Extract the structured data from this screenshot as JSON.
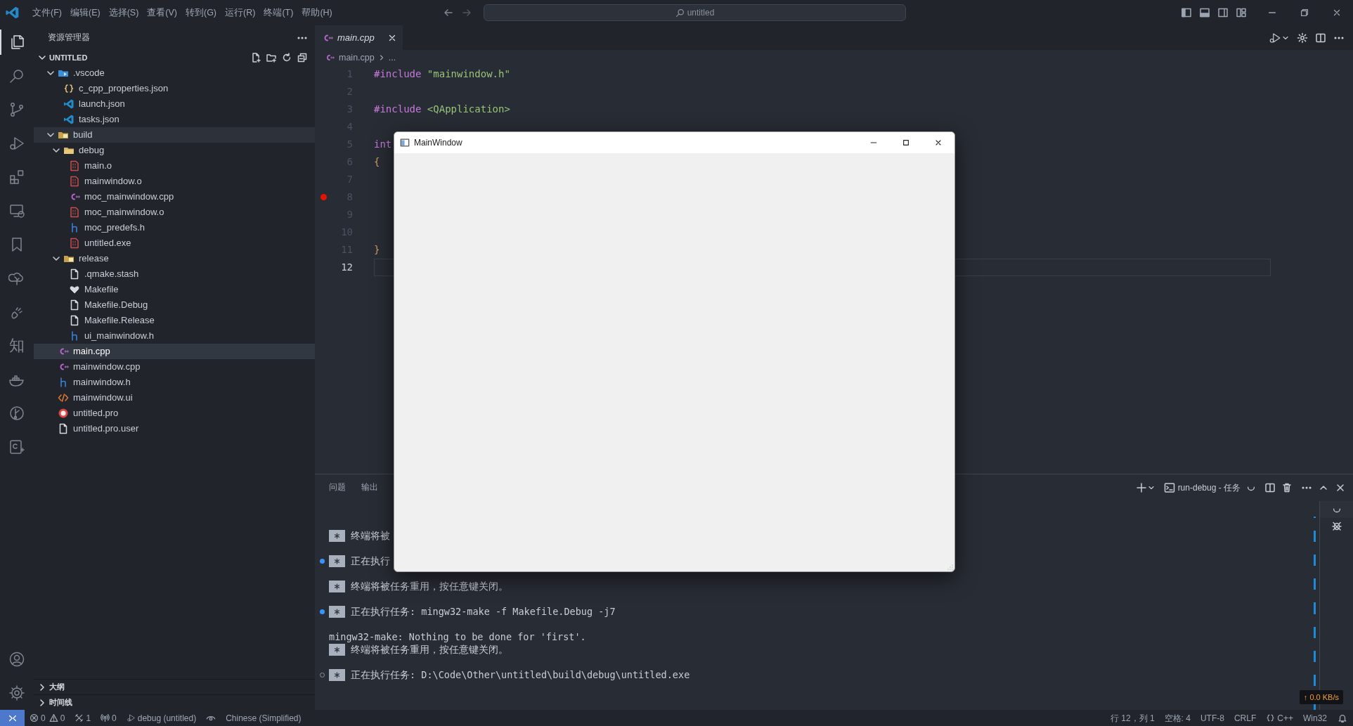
{
  "title_bar": {
    "menus": [
      "文件(F)",
      "编辑(E)",
      "选择(S)",
      "查看(V)",
      "转到(G)",
      "运行(R)",
      "终端(T)",
      "帮助(H)"
    ],
    "search": {
      "text": "untitled"
    }
  },
  "activity_bar": {
    "items": [
      {
        "kind": "explorer",
        "selected": true
      },
      {
        "kind": "search",
        "selected": false
      },
      {
        "kind": "git",
        "selected": false
      },
      {
        "kind": "debug",
        "selected": false
      },
      {
        "kind": "extensions",
        "selected": false
      },
      {
        "kind": "remote",
        "selected": false
      },
      {
        "kind": "bookmark",
        "selected": false
      },
      {
        "kind": "tree",
        "selected": false
      },
      {
        "kind": "hand",
        "selected": false
      },
      {
        "kind": "glyph",
        "text": "知",
        "selected": false
      },
      {
        "kind": "docker",
        "selected": false
      },
      {
        "kind": "graph",
        "selected": false
      },
      {
        "kind": "cmake",
        "selected": false
      }
    ],
    "bottom": [
      {
        "kind": "account"
      },
      {
        "kind": "settings"
      }
    ]
  },
  "sidebar": {
    "title": "资源管理器",
    "workspace": {
      "label": "UNTITLED",
      "expanded": true
    },
    "tree": [
      {
        "label": ".vscode",
        "kind": "vscodefolder",
        "expanded": true,
        "selected": false,
        "hovered": false,
        "children": [
          {
            "label": "c_cpp_properties.json",
            "kind": "braces",
            "selected": false,
            "hovered": false
          },
          {
            "label": "launch.json",
            "kind": "vscode",
            "selected": false,
            "hovered": false
          },
          {
            "label": "tasks.json",
            "kind": "vscode",
            "selected": false,
            "hovered": false
          }
        ]
      },
      {
        "label": "build",
        "kind": "buildfolder",
        "expanded": true,
        "selected": false,
        "hovered": true,
        "children": [
          {
            "label": "debug",
            "kind": "folder",
            "expanded": true,
            "selected": false,
            "hovered": false,
            "children": [
              {
                "label": "main.o",
                "kind": "binary",
                "selected": false,
                "hovered": false
              },
              {
                "label": "mainwindow.o",
                "kind": "binary",
                "selected": false,
                "hovered": false
              },
              {
                "label": "moc_mainwindow.cpp",
                "kind": "cpp",
                "selected": false,
                "hovered": false
              },
              {
                "label": "moc_mainwindow.o",
                "kind": "binary",
                "selected": false,
                "hovered": false
              },
              {
                "label": "moc_predefs.h",
                "kind": "header",
                "selected": false,
                "hovered": false
              },
              {
                "label": "untitled.exe",
                "kind": "binary",
                "selected": false,
                "hovered": false
              }
            ]
          },
          {
            "label": "release",
            "kind": "buildfolder",
            "expanded": true,
            "selected": false,
            "hovered": false,
            "children": [
              {
                "label": ".qmake.stash",
                "kind": "plain",
                "selected": false,
                "hovered": false
              },
              {
                "label": "Makefile",
                "kind": "makefile",
                "selected": false,
                "hovered": false
              },
              {
                "label": "Makefile.Debug",
                "kind": "plain",
                "selected": false,
                "hovered": false
              },
              {
                "label": "Makefile.Release",
                "kind": "plain",
                "selected": false,
                "hovered": false
              },
              {
                "label": "ui_mainwindow.h",
                "kind": "header",
                "selected": false,
                "hovered": false
              }
            ]
          }
        ]
      },
      {
        "label": "main.cpp",
        "kind": "cpp",
        "selected": true,
        "hovered": false
      },
      {
        "label": "mainwindow.cpp",
        "kind": "cpp",
        "selected": false,
        "hovered": false
      },
      {
        "label": "mainwindow.h",
        "kind": "header",
        "selected": false,
        "hovered": false
      },
      {
        "label": "mainwindow.ui",
        "kind": "xml",
        "selected": false,
        "hovered": false
      },
      {
        "label": "untitled.pro",
        "kind": "qt",
        "selected": false,
        "hovered": false
      },
      {
        "label": "untitled.pro.user",
        "kind": "plain",
        "selected": false,
        "hovered": false
      }
    ],
    "sections": [
      {
        "label": "大纲",
        "expanded": false
      },
      {
        "label": "时间线",
        "expanded": false
      }
    ]
  },
  "editor": {
    "tabs": [
      {
        "label": "main.cpp",
        "selected": true
      }
    ],
    "breadcrumbs": [
      "main.cpp",
      "..."
    ],
    "lines": [
      {
        "number": "1",
        "breakpoint": false,
        "current": false,
        "tokens": [
          {
            "text": "#include",
            "kind": "keyword"
          },
          {
            "text": "\"mainwindow.h\"",
            "kind": "string"
          }
        ]
      },
      {
        "number": "2",
        "breakpoint": false,
        "current": false
      },
      {
        "number": "3",
        "breakpoint": false,
        "current": false,
        "tokens": [
          {
            "text": "#include",
            "kind": "keyword"
          },
          {
            "text": "<QApplication>",
            "kind": "string"
          }
        ]
      },
      {
        "number": "4",
        "breakpoint": false,
        "current": false
      },
      {
        "number": "5",
        "breakpoint": false,
        "current": false,
        "tokens": [
          {
            "text": "int",
            "kind": "keyword"
          }
        ]
      },
      {
        "number": "6",
        "breakpoint": false,
        "current": false,
        "tokens": [
          {
            "text": "{",
            "kind": "bracket"
          }
        ]
      },
      {
        "number": "7",
        "breakpoint": false,
        "current": false
      },
      {
        "number": "8",
        "breakpoint": true,
        "current": false
      },
      {
        "number": "9",
        "breakpoint": false,
        "current": false
      },
      {
        "number": "10",
        "breakpoint": false,
        "current": false
      },
      {
        "number": "11",
        "breakpoint": false,
        "current": false,
        "tokens": [
          {
            "text": "}",
            "kind": "bracket"
          }
        ]
      },
      {
        "number": "12",
        "breakpoint": false,
        "current": true
      }
    ]
  },
  "panel": {
    "tabs": [
      {
        "label": "问题",
        "selected": false
      },
      {
        "label": "输出",
        "selected": false
      }
    ],
    "terminal_name": "run-debug - 任务",
    "lines": [
      {
        "kind": "blank"
      },
      {
        "kind": "blank"
      },
      {
        "kind": "task",
        "text": "终端将被"
      },
      {
        "kind": "blank"
      },
      {
        "kind": "task",
        "text": "正在执行",
        "success": true
      },
      {
        "kind": "blank"
      },
      {
        "kind": "task",
        "text": "终端将被任务重用，按任意键关闭。"
      },
      {
        "kind": "blank"
      },
      {
        "kind": "task",
        "text": "正在执行任务: mingw32-make -f Makefile.Debug -j7",
        "success": true
      },
      {
        "kind": "blank"
      },
      {
        "kind": "output",
        "text": "mingw32-make: Nothing to be done for 'first'."
      },
      {
        "kind": "task",
        "text": "终端将被任务重用，按任意键关闭。"
      },
      {
        "kind": "blank"
      },
      {
        "kind": "task",
        "text": "正在执行任务: D:\\Code\\Other\\untitled\\build\\debug\\untitled.exe",
        "success": false
      }
    ],
    "net_speed": "↑ 0.0 KB/s"
  },
  "qt_window": {
    "title": "MainWindow"
  },
  "status_bar": {
    "errors": "0",
    "warnings": "0",
    "tools": "1",
    "ports": "0",
    "debug": "debug (untitled)",
    "language_pack": "Chinese (Simplified)",
    "position": "行 12，列 1",
    "indent": "空格: 4",
    "encoding": "UTF-8",
    "eol": "CRLF",
    "language": "C++",
    "platform": "Win32"
  }
}
